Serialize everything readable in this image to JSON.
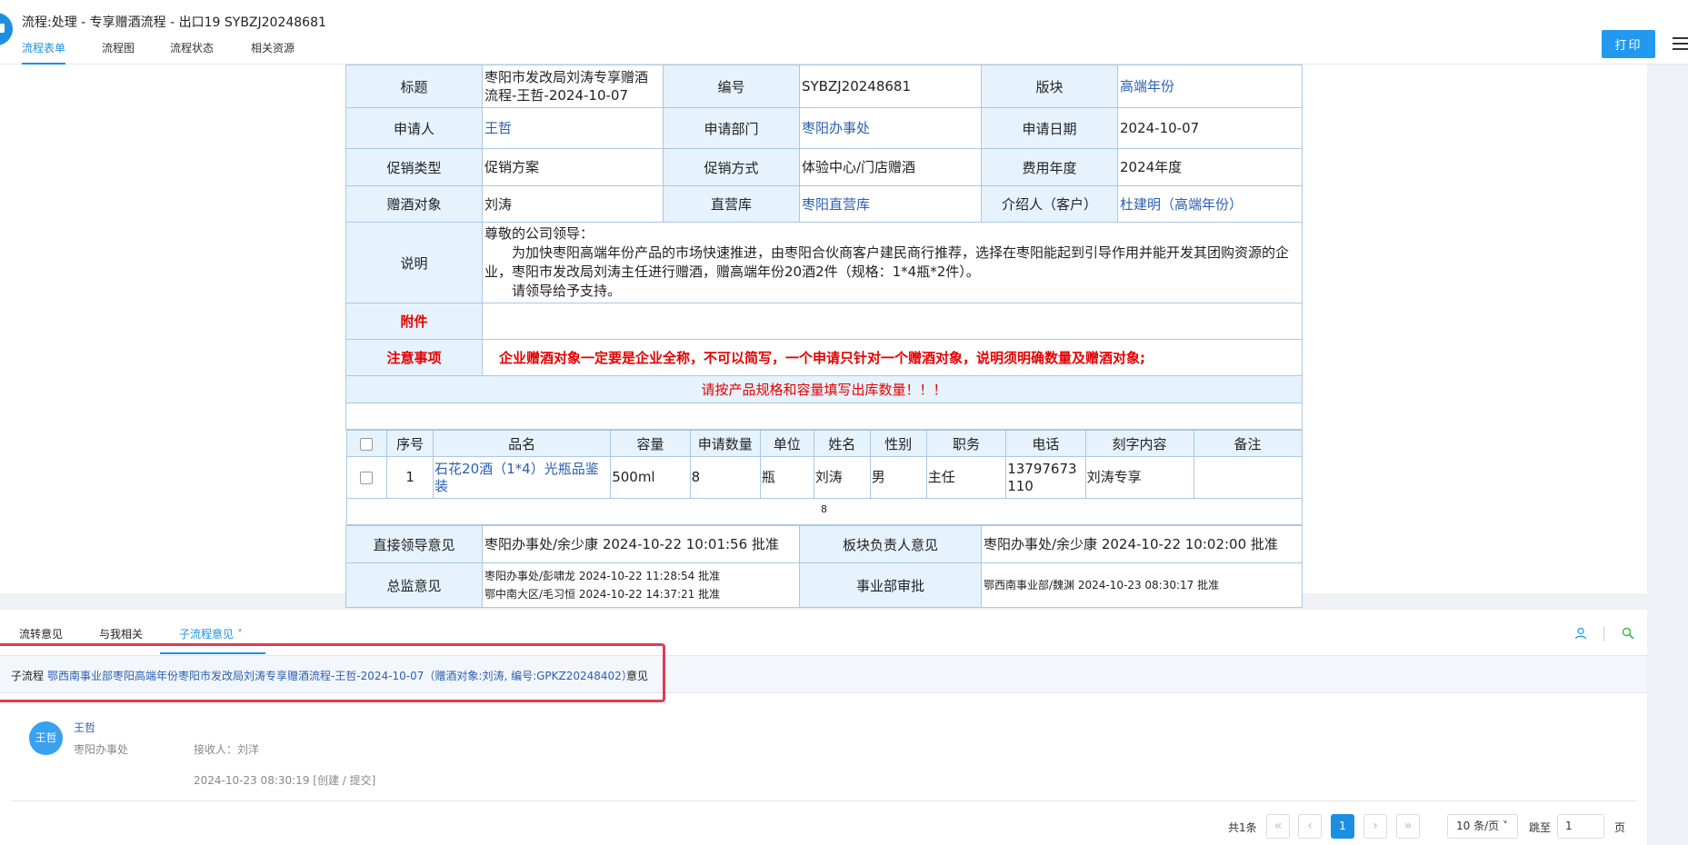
{
  "header": {
    "title": "流程:处理 - 专享赠酒流程 - 出口19 SYBZJ20248681",
    "tabs": [
      {
        "label": "流程表单"
      },
      {
        "label": "流程图"
      },
      {
        "label": "流程状态"
      },
      {
        "label": "相关资源"
      }
    ],
    "print_label": "打印"
  },
  "form": {
    "rows": {
      "title_label": "标题",
      "title_value": "枣阳市发改局刘涛专享赠酒流程-王哲-2024-10-07",
      "code_label": "编号",
      "code_value": "SYBZJ20248681",
      "block_label": "版块",
      "block_value": "高端年份",
      "applicant_label": "申请人",
      "applicant_value": "王哲",
      "dept_label": "申请部门",
      "dept_value": "枣阳办事处",
      "date_label": "申请日期",
      "date_value": "2024-10-07",
      "promo_type_label": "促销类型",
      "promo_type_value": "促销方案",
      "promo_method_label": "促销方式",
      "promo_method_value": "体验中心/门店赠酒",
      "fee_year_label": "费用年度",
      "fee_year_value": "2024年度",
      "target_label": "赠酒对象",
      "target_value": "刘涛",
      "store_label": "直营库",
      "store_value": "枣阳直营库",
      "referrer_label": "介绍人（客户）",
      "referrer_value": "杜建明（高端年份）",
      "desc_label": "说明",
      "desc_line1": "尊敬的公司领导：",
      "desc_line2": "为加快枣阳高端年份产品的市场快速推进，由枣阳合伙商客户建民商行推荐，选择在枣阳能起到引导作用并能开发其团购资源的企业，枣阳市发改局刘涛主任进行赠酒，赠高端年份20酒2件（规格：1*4瓶*2件）。",
      "desc_line3": "请领导给予支持。",
      "attach_label": "附件",
      "notes_label": "注意事项",
      "notes_value": "企业赠酒对象一定要是企业全称，不可以简写，一个申请只针对一个赠酒对象，说明须明确数量及赠酒对象;",
      "notice": "请按产品规格和容量填写出库数量！！！"
    },
    "items": {
      "headers": [
        "序号",
        "品名",
        "容量",
        "申请数量",
        "单位",
        "姓名",
        "性别",
        "职务",
        "电话",
        "刻字内容",
        "备注"
      ],
      "rows": [
        {
          "no": "1",
          "name": "石花20酒（1*4）光瓶品鉴装",
          "capacity": "500ml",
          "qty": "8",
          "unit": "瓶",
          "person": "刘涛",
          "gender": "男",
          "title": "主任",
          "phone": "13797673110",
          "engrave": "刘涛专享",
          "remark": ""
        }
      ],
      "total": "8"
    },
    "approvals": {
      "direct_label": "直接领导意见",
      "direct_value": "枣阳办事处/余少康 2024-10-22 10:01:56 批准",
      "block_head_label": "板块负责人意见",
      "block_head_value": "枣阳办事处/余少康 2024-10-22 10:02:00 批准",
      "director_label": "总监意见",
      "director_line1": "枣阳办事处/彭啸龙 2024-10-22 11:28:54 批准",
      "director_line2": "鄂中南大区/毛习恒 2024-10-22 14:37:21 批准",
      "division_label": "事业部审批",
      "division_value": "鄂西南事业部/魏渊 2024-10-23 08:30:17 批准"
    }
  },
  "lower": {
    "tabs": [
      {
        "label": "流转意见"
      },
      {
        "label": "与我相关"
      },
      {
        "label": "子流程意见 ˅"
      }
    ],
    "subflow_prefix": "子流程",
    "subflow_link": "鄂西南事业部枣阳高端年份枣阳市发改局刘涛专享赠酒流程-王哲-2024-10-07（赠酒对象:刘涛, 编号:GPKZ20248402）",
    "subflow_suffix": "意见",
    "comment": {
      "avatar": "王哲",
      "name": "王哲",
      "dept": "枣阳办事处",
      "receiver": "接收人：刘洋",
      "time": "2024-10-23 08:30:19  [创建 / 提交]"
    },
    "pager": {
      "total": "共1条",
      "current": "1",
      "page_size": "10 条/页 ˅",
      "goto_label": "跳至",
      "goto_value": "1",
      "page_unit": "页"
    }
  },
  "colors": {
    "accent": "#1d8fe1",
    "label_bg": "#e6f2fc",
    "border": "#aac8e3",
    "warn": "#e60000",
    "link": "#2a5fb3",
    "highlight": "#e43a4f"
  }
}
